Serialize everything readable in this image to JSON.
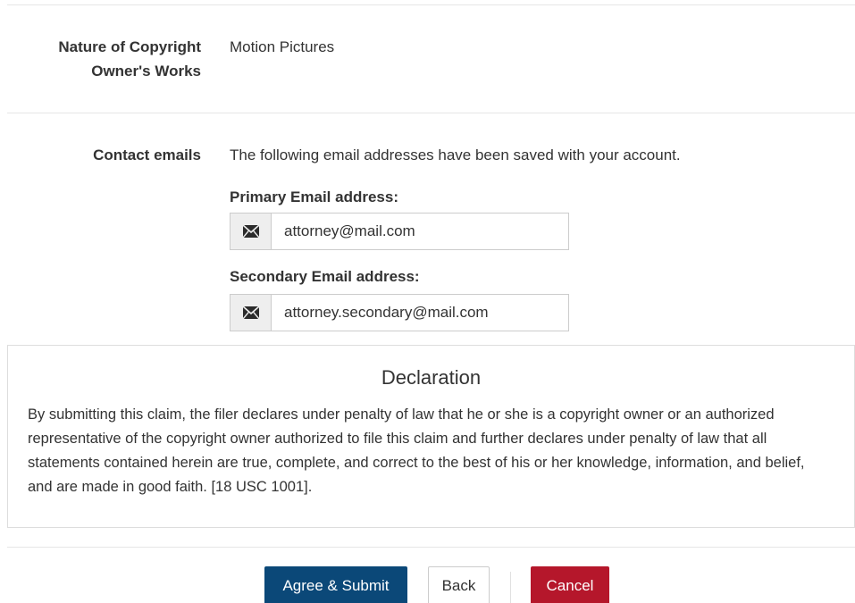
{
  "nature": {
    "label_line1": "Nature of Copyright",
    "label_line2": "Owner's Works",
    "value": "Motion Pictures"
  },
  "contact": {
    "label": "Contact emails",
    "description": "The following email addresses have been saved with your account.",
    "primary_label": "Primary Email address:",
    "primary_value": "attorney@mail.com",
    "secondary_label": "Secondary Email address:",
    "secondary_value": "attorney.secondary@mail.com"
  },
  "declaration": {
    "title": "Declaration",
    "text": "By submitting this claim, the filer declares under penalty of law that he or she is a copyright owner or an authorized representative of the copyright owner authorized to file this claim and further declares under penalty of law that all statements contained herein are true, complete, and correct to the best of his or her knowledge, information, and belief, and are made in good faith. [18 USC 1001]."
  },
  "actions": {
    "submit_label": "Agree & Submit",
    "back_label": "Back",
    "cancel_label": "Cancel"
  },
  "icons": {
    "email": "envelope-icon"
  },
  "colors": {
    "primary": "#0b4878",
    "danger": "#b5172b",
    "text": "#333333",
    "addon_bg": "#eeeeee"
  }
}
